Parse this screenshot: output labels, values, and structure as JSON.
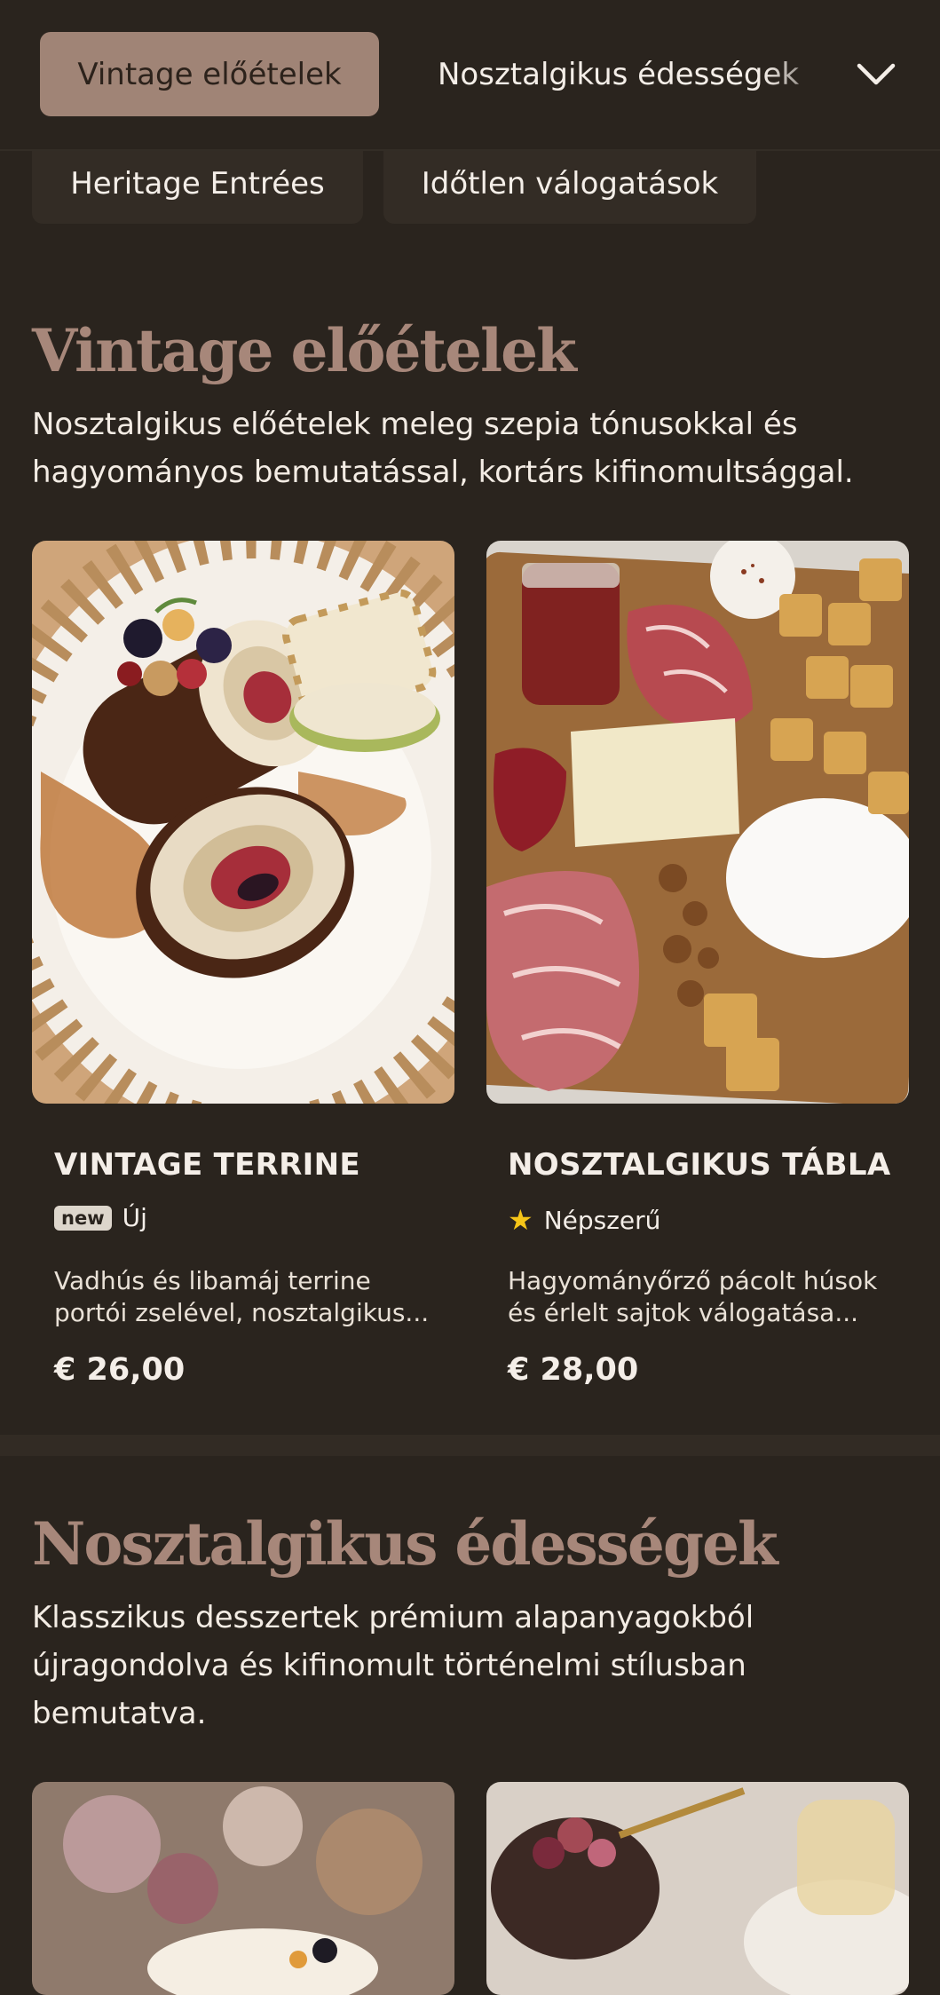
{
  "categories": {
    "active": "Vintage előételek",
    "next": "Nosztalgikus édességek",
    "second_row": [
      "Heritage Entrées",
      "Időtlen válogatások"
    ]
  },
  "sections": [
    {
      "title": "Vintage előételek",
      "description": "Nosztalgikus előételek meleg szepia tónusokkal és hagyományos bemutatással, kortárs kifinomultsággal.",
      "items": [
        {
          "name": "VINTAGE TERRINE",
          "badge": "new",
          "tag": "Új",
          "description": "Vadhús és libamáj terrine portói zselével, nosztalgikus...",
          "price": "€ 26,00"
        },
        {
          "name": "NOSZTALGIKUS TÁBLA",
          "badge_icon": "star-icon",
          "tag": "Népszerű",
          "description": "Hagyományőrző pácolt húsok és érlelt sajtok válogatása...",
          "price": "€ 28,00"
        }
      ]
    },
    {
      "title": "Nosztalgikus édességek",
      "description": "Klasszikus desszertek prémium alapanyagokból újragondolva és kifinomult történelmi stílusban bemutatva."
    }
  ],
  "colors": {
    "background": "#2a241e",
    "accent": "#a08476",
    "title": "#a7877a",
    "star": "#f5c518"
  }
}
